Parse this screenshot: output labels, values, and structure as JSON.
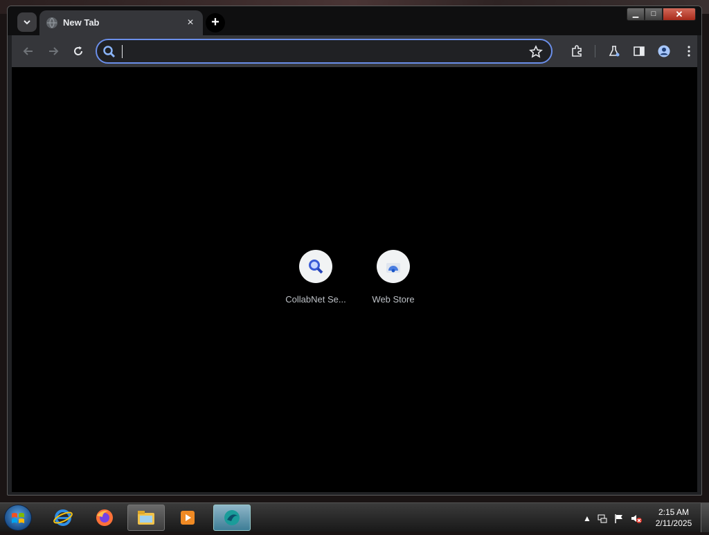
{
  "browser": {
    "tab": {
      "title": "New Tab",
      "close": "×"
    },
    "new_tab_label": "+",
    "omnibox": {
      "value": "",
      "placeholder": ""
    },
    "window_controls": {
      "minimize": "▁",
      "maximize": "□",
      "close": "✕"
    }
  },
  "shortcuts": [
    {
      "label": "CollabNet Se...",
      "icon": "magnifier-icon"
    },
    {
      "label": "Web Store",
      "icon": "web-store-icon"
    }
  ],
  "taskbar": {
    "apps": [
      "internet-explorer-icon",
      "firefox-icon",
      "file-explorer-icon",
      "media-player-icon",
      "browser-app-icon"
    ],
    "clock": {
      "time": "2:15 AM",
      "date": "2/11/2025"
    }
  },
  "colors": {
    "accent": "#6b8fea",
    "content_bg": "#000000",
    "toolbar_bg": "#35363a"
  }
}
